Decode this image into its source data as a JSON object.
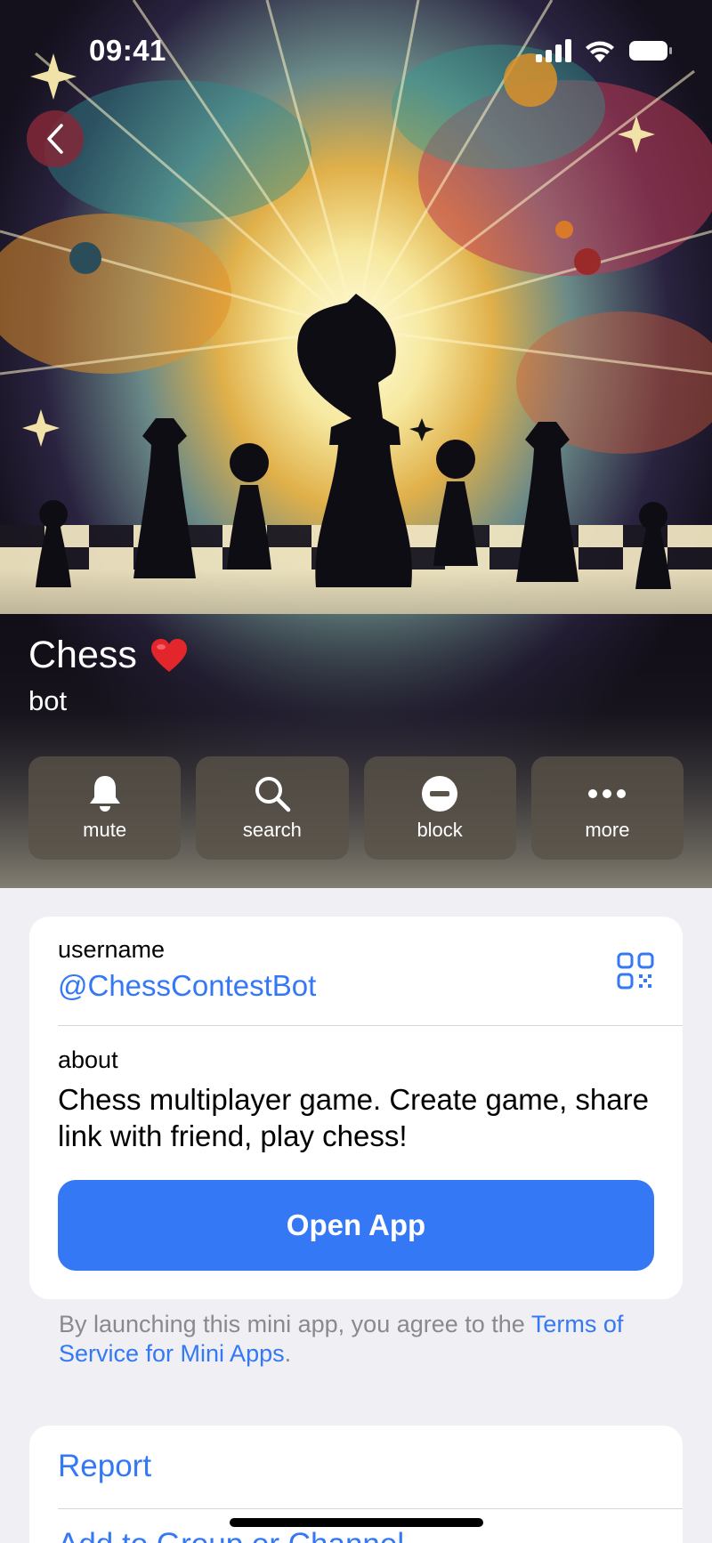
{
  "status_bar": {
    "time": "09:41"
  },
  "profile": {
    "name": "Chess",
    "emoji": "❤️",
    "subtitle": "bot"
  },
  "actions": [
    {
      "label": "mute",
      "icon": "bell-icon"
    },
    {
      "label": "search",
      "icon": "search-icon"
    },
    {
      "label": "block",
      "icon": "block-icon"
    },
    {
      "label": "more",
      "icon": "more-icon"
    }
  ],
  "info": {
    "username_label": "username",
    "username": "@ChessContestBot",
    "about_label": "about",
    "about": "Chess multiplayer game. Create game, share link with friend, play chess!",
    "open_app": "Open App"
  },
  "terms": {
    "text": "By launching this mini app, you agree to the ",
    "link": "Terms of Service for Mini Apps",
    "end": "."
  },
  "menu": {
    "report": "Report",
    "add_to": "Add to Group or Channel"
  },
  "colors": {
    "accent": "#3478f6",
    "background": "#efeff4"
  }
}
